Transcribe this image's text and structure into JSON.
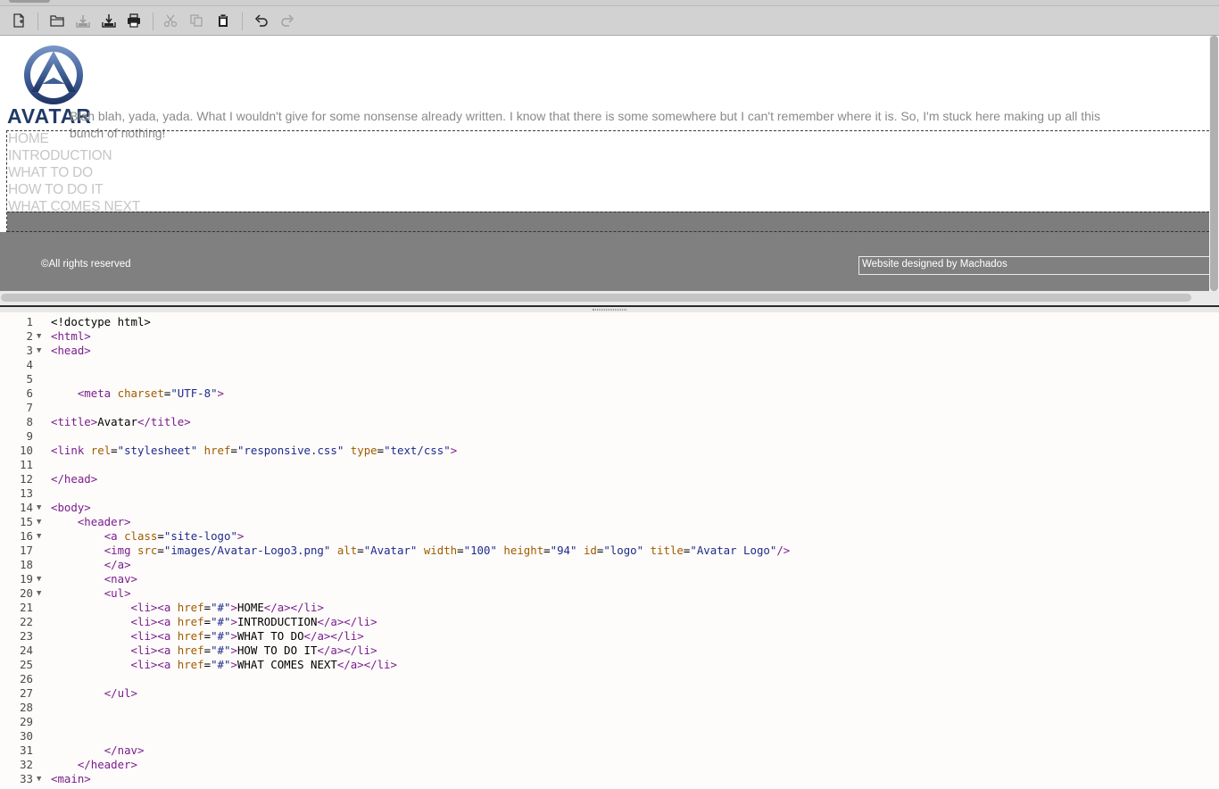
{
  "toolbar": {
    "buttons": [
      "new-file",
      "open",
      "save",
      "save-as",
      "print",
      "cut",
      "copy",
      "paste",
      "undo",
      "redo"
    ]
  },
  "preview": {
    "logo_text": "AVATAR",
    "intro_text": "Blah blah, yada, yada. What I wouldn't give for some nonsense already written. I know that there is some somewhere but I can't remember where it is. So, I'm stuck here making up all this bunch of nothing!",
    "nav": [
      "HOME",
      "INTRODUCTION",
      "WHAT TO DO",
      "HOW TO DO IT",
      "WHAT COMES NEXT"
    ],
    "footer_left": "©All rights reserved",
    "footer_right": "Website designed by Machados"
  },
  "editor": {
    "lines": [
      {
        "n": "1",
        "fold": "",
        "html": "&lt;!doctype html&gt;"
      },
      {
        "n": "2",
        "fold": "▼",
        "html": "<span class='tag'>&lt;html&gt;</span>"
      },
      {
        "n": "3",
        "fold": "▼",
        "html": "<span class='tag'>&lt;head&gt;</span>"
      },
      {
        "n": "4",
        "fold": "",
        "html": ""
      },
      {
        "n": "5",
        "fold": "",
        "html": ""
      },
      {
        "n": "6",
        "fold": "",
        "html": "    <span class='tag'>&lt;meta</span> <span class='attr'>charset</span>=<span class='val'>\"UTF-8\"</span><span class='tag'>&gt;</span>"
      },
      {
        "n": "7",
        "fold": "",
        "html": ""
      },
      {
        "n": "8",
        "fold": "",
        "html": "<span class='tag'>&lt;title&gt;</span>Avatar<span class='tag'>&lt;/title&gt;</span>"
      },
      {
        "n": "9",
        "fold": "",
        "html": ""
      },
      {
        "n": "10",
        "fold": "",
        "html": "<span class='tag'>&lt;link</span> <span class='attr'>rel</span>=<span class='val'>\"stylesheet\"</span> <span class='attr'>href</span>=<span class='val'>\"responsive.css\"</span> <span class='attr'>type</span>=<span class='val'>\"text/css\"</span><span class='tag'>&gt;</span>"
      },
      {
        "n": "11",
        "fold": "",
        "html": ""
      },
      {
        "n": "12",
        "fold": "",
        "html": "<span class='tag'>&lt;/head&gt;</span>"
      },
      {
        "n": "13",
        "fold": "",
        "html": ""
      },
      {
        "n": "14",
        "fold": "▼",
        "html": "<span class='tag'>&lt;body&gt;</span>"
      },
      {
        "n": "15",
        "fold": "▼",
        "html": "    <span class='tag'>&lt;header&gt;</span>"
      },
      {
        "n": "16",
        "fold": "▼",
        "html": "        <span class='tag'>&lt;a</span> <span class='attr'>class</span>=<span class='val'>\"site-logo\"</span><span class='tag'>&gt;</span>"
      },
      {
        "n": "17",
        "fold": "",
        "html": "        <span class='tag'>&lt;img</span> <span class='attr'>src</span>=<span class='val'>\"images/Avatar-Logo3.png\"</span> <span class='attr'>alt</span>=<span class='val'>\"Avatar\"</span> <span class='attr'>width</span>=<span class='val'>\"100\"</span> <span class='attr'>height</span>=<span class='val'>\"94\"</span> <span class='attr'>id</span>=<span class='val'>\"logo\"</span> <span class='attr'>title</span>=<span class='val'>\"Avatar Logo\"</span><span class='tag'>/&gt;</span>"
      },
      {
        "n": "18",
        "fold": "",
        "html": "        <span class='tag'>&lt;/a&gt;</span>"
      },
      {
        "n": "19",
        "fold": "▼",
        "html": "        <span class='tag'>&lt;nav&gt;</span>"
      },
      {
        "n": "20",
        "fold": "▼",
        "html": "        <span class='tag'>&lt;ul&gt;</span>"
      },
      {
        "n": "21",
        "fold": "",
        "html": "            <span class='tag'>&lt;li&gt;&lt;a</span> <span class='attr'>href</span>=<span class='val'>\"#\"</span><span class='tag'>&gt;</span>HOME<span class='tag'>&lt;/a&gt;&lt;/li&gt;</span>"
      },
      {
        "n": "22",
        "fold": "",
        "html": "            <span class='tag'>&lt;li&gt;&lt;a</span> <span class='attr'>href</span>=<span class='val'>\"#\"</span><span class='tag'>&gt;</span>INTRODUCTION<span class='tag'>&lt;/a&gt;&lt;/li&gt;</span>"
      },
      {
        "n": "23",
        "fold": "",
        "html": "            <span class='tag'>&lt;li&gt;&lt;a</span> <span class='attr'>href</span>=<span class='val'>\"#\"</span><span class='tag'>&gt;</span>WHAT TO DO<span class='tag'>&lt;/a&gt;&lt;/li&gt;</span>"
      },
      {
        "n": "24",
        "fold": "",
        "html": "            <span class='tag'>&lt;li&gt;&lt;a</span> <span class='attr'>href</span>=<span class='val'>\"#\"</span><span class='tag'>&gt;</span>HOW TO DO IT<span class='tag'>&lt;/a&gt;&lt;/li&gt;</span>"
      },
      {
        "n": "25",
        "fold": "",
        "html": "            <span class='tag'>&lt;li&gt;&lt;a</span> <span class='attr'>href</span>=<span class='val'>\"#\"</span><span class='tag'>&gt;</span>WHAT COMES NEXT<span class='tag'>&lt;/a&gt;&lt;/li&gt;</span>"
      },
      {
        "n": "26",
        "fold": "",
        "html": ""
      },
      {
        "n": "27",
        "fold": "",
        "html": "        <span class='tag'>&lt;/ul&gt;</span>"
      },
      {
        "n": "28",
        "fold": "",
        "html": ""
      },
      {
        "n": "29",
        "fold": "",
        "html": ""
      },
      {
        "n": "30",
        "fold": "",
        "html": ""
      },
      {
        "n": "31",
        "fold": "",
        "html": "        <span class='tag'>&lt;/nav&gt;</span>"
      },
      {
        "n": "32",
        "fold": "",
        "html": "    <span class='tag'>&lt;/header&gt;</span>"
      },
      {
        "n": "33",
        "fold": "▼",
        "html": "<span class='tag'>&lt;main&gt;</span>"
      }
    ]
  }
}
